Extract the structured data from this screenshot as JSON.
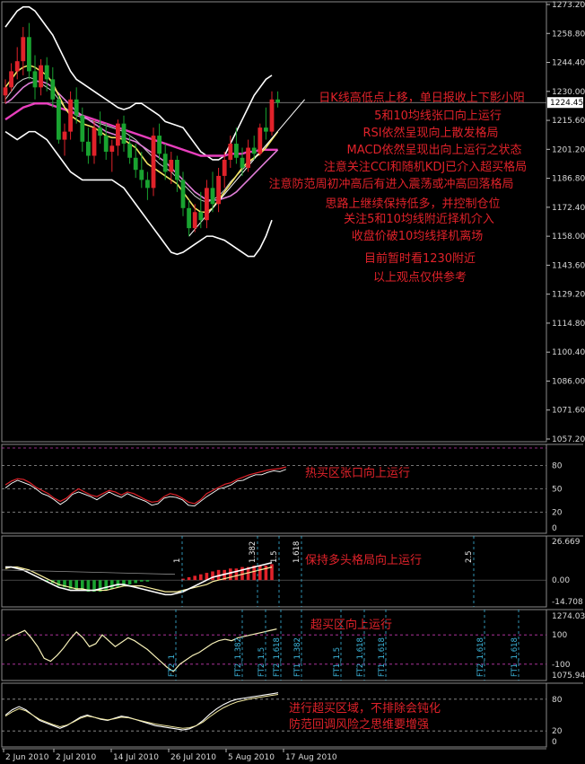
{
  "chart_data": [
    {
      "type": "candlestick",
      "panel": "price",
      "ylim": [
        1057.2,
        1273.2
      ],
      "y_ticks": [
        "1273.20",
        "1258.80",
        "1244.40",
        "1230.00",
        "1215.60",
        "1201.20",
        "1186.80",
        "1172.40",
        "1158.00",
        "1143.60",
        "1129.20",
        "1114.80",
        "1100.40",
        "1086.00",
        "1071.60",
        "1057.20"
      ],
      "last_price": "1224.45",
      "x_ticks": [
        "2 Jun 2010",
        "2 Jul 2010",
        "14 Jul 2010",
        "26 Jul 2010",
        "5 Aug 2010",
        "17 Aug 2010"
      ],
      "candles": [
        [
          1228,
          1236,
          1224,
          1232
        ],
        [
          1232,
          1244,
          1230,
          1240
        ],
        [
          1240,
          1252,
          1236,
          1245
        ],
        [
          1245,
          1262,
          1238,
          1257
        ],
        [
          1257,
          1264,
          1236,
          1240
        ],
        [
          1240,
          1248,
          1226,
          1232
        ],
        [
          1232,
          1246,
          1228,
          1243
        ],
        [
          1243,
          1247,
          1230,
          1236
        ],
        [
          1236,
          1242,
          1222,
          1226
        ],
        [
          1226,
          1228,
          1204,
          1206
        ],
        [
          1206,
          1214,
          1198,
          1210
        ],
        [
          1210,
          1230,
          1206,
          1226
        ],
        [
          1226,
          1232,
          1214,
          1218
        ],
        [
          1218,
          1222,
          1200,
          1205
        ],
        [
          1205,
          1212,
          1194,
          1198
        ],
        [
          1198,
          1216,
          1194,
          1212
        ],
        [
          1212,
          1220,
          1204,
          1208
        ],
        [
          1208,
          1214,
          1196,
          1200
        ],
        [
          1200,
          1206,
          1190,
          1203
        ],
        [
          1203,
          1216,
          1198,
          1214
        ],
        [
          1214,
          1218,
          1200,
          1204
        ],
        [
          1204,
          1208,
          1194,
          1197
        ],
        [
          1197,
          1204,
          1187,
          1191
        ],
        [
          1191,
          1200,
          1182,
          1186
        ],
        [
          1186,
          1190,
          1176,
          1182
        ],
        [
          1182,
          1212,
          1178,
          1208
        ],
        [
          1208,
          1214,
          1196,
          1199
        ],
        [
          1199,
          1204,
          1186,
          1190
        ],
        [
          1190,
          1200,
          1184,
          1196
        ],
        [
          1196,
          1198,
          1180,
          1186
        ],
        [
          1186,
          1190,
          1168,
          1172
        ],
        [
          1172,
          1176,
          1158,
          1162
        ],
        [
          1162,
          1174,
          1160,
          1170
        ],
        [
          1170,
          1180,
          1162,
          1166
        ],
        [
          1166,
          1186,
          1162,
          1182
        ],
        [
          1182,
          1190,
          1170,
          1174
        ],
        [
          1174,
          1192,
          1170,
          1188
        ],
        [
          1188,
          1200,
          1182,
          1196
        ],
        [
          1196,
          1208,
          1192,
          1204
        ],
        [
          1204,
          1212,
          1194,
          1197
        ],
        [
          1197,
          1202,
          1188,
          1192
        ],
        [
          1192,
          1206,
          1190,
          1202
        ],
        [
          1202,
          1208,
          1196,
          1199
        ],
        [
          1199,
          1214,
          1198,
          1212
        ],
        [
          1212,
          1222,
          1206,
          1210
        ],
        [
          1210,
          1230,
          1208,
          1226
        ],
        [
          1226,
          1230,
          1222,
          1224.45
        ]
      ],
      "bollinger_upper": [
        1262,
        1266,
        1270,
        1272,
        1272,
        1270,
        1266,
        1262,
        1258,
        1252,
        1246,
        1240,
        1236,
        1234,
        1232,
        1230,
        1228,
        1226,
        1224,
        1222,
        1221,
        1222,
        1224,
        1224,
        1222,
        1220,
        1218,
        1215,
        1214,
        1213,
        1212,
        1208,
        1204,
        1200,
        1198,
        1196,
        1196,
        1198,
        1204,
        1210,
        1216,
        1222,
        1228,
        1232,
        1236,
        1238
      ],
      "bollinger_mid": [
        1226,
        1230,
        1234,
        1236,
        1237,
        1236,
        1234,
        1232,
        1230,
        1226,
        1222,
        1220,
        1218,
        1217,
        1216,
        1215,
        1214,
        1213,
        1212,
        1211,
        1210,
        1208,
        1206,
        1203,
        1200,
        1197,
        1194,
        1192,
        1190,
        1187,
        1184,
        1181,
        1178,
        1176,
        1175,
        1176,
        1178,
        1181,
        1185,
        1188,
        1191,
        1194,
        1197,
        1200,
        1203,
        1206
      ],
      "bollinger_lower": [
        1210,
        1208,
        1206,
        1208,
        1210,
        1210,
        1208,
        1206,
        1202,
        1198,
        1194,
        1190,
        1188,
        1186,
        1186,
        1186,
        1186,
        1186,
        1186,
        1184,
        1182,
        1178,
        1174,
        1170,
        1166,
        1162,
        1158,
        1154,
        1150,
        1149,
        1150,
        1152,
        1154,
        1156,
        1158,
        1158,
        1157,
        1156,
        1154,
        1152,
        1150,
        1148,
        1148,
        1152,
        1158,
        1166
      ],
      "ma5": [
        1232,
        1236,
        1240,
        1242,
        1243,
        1242,
        1240,
        1238,
        1234,
        1228,
        1222,
        1218,
        1216,
        1214,
        1213,
        1212,
        1210,
        1208,
        1207,
        1207,
        1206,
        1204,
        1202,
        1198,
        1194,
        1192,
        1190,
        1188,
        1186,
        1184,
        1180,
        1176,
        1172,
        1170,
        1170,
        1172,
        1176,
        1180,
        1184,
        1188,
        1192,
        1195,
        1197,
        1199,
        1202,
        1206,
        1210
      ],
      "ma10": [
        1224,
        1226,
        1229,
        1232,
        1234,
        1235,
        1235,
        1234,
        1232,
        1229,
        1226,
        1223,
        1220,
        1218,
        1216,
        1214,
        1212,
        1210,
        1209,
        1208,
        1207,
        1206,
        1205,
        1203,
        1201,
        1199,
        1197,
        1195,
        1192,
        1189,
        1186,
        1183,
        1180,
        1178,
        1176,
        1176,
        1176,
        1177,
        1178,
        1180,
        1183,
        1186,
        1189,
        1192,
        1195,
        1198,
        1201
      ],
      "ma_long": [
        1216,
        1218,
        1220,
        1222,
        1223,
        1224,
        1224,
        1224,
        1223,
        1222,
        1221,
        1220,
        1219,
        1218,
        1217,
        1216,
        1215,
        1214,
        1213,
        1212,
        1211,
        1210,
        1209,
        1208,
        1207,
        1206,
        1205,
        1204,
        1203,
        1202,
        1201,
        1200,
        1199,
        1198,
        1198,
        1198,
        1198,
        1198,
        1199,
        1199,
        1199,
        1200,
        1200,
        1201,
        1201,
        1201,
        1201
      ]
    },
    {
      "type": "line",
      "panel": "rsi",
      "ylim": [
        0,
        100
      ],
      "y_ticks": [
        "80",
        "50",
        "20",
        "0"
      ],
      "series": [
        {
          "values": [
            55,
            60,
            63,
            62,
            58,
            52,
            48,
            44,
            38,
            34,
            38,
            45,
            50,
            46,
            42,
            40,
            44,
            48,
            46,
            42,
            46,
            44,
            40,
            36,
            33,
            34,
            40,
            44,
            42,
            38,
            33,
            31,
            36,
            44,
            48,
            52,
            56,
            58,
            62,
            65,
            68,
            70,
            72,
            74,
            75,
            76,
            78
          ]
        }
      ]
    },
    {
      "type": "bar",
      "panel": "macd",
      "ylim": [
        -14.708,
        26.669
      ],
      "y_ticks": [
        "26.669",
        "0.00",
        "-14.708"
      ],
      "fib_labels": [
        "1",
        "1.382",
        "1.5",
        "1.618",
        "2.5"
      ],
      "histogram": [
        0,
        0,
        0,
        0,
        0,
        0,
        0,
        -1,
        -2,
        -4,
        -5,
        -6,
        -7,
        -7,
        -8,
        -8,
        -8,
        -7,
        -6,
        -5,
        -4,
        -3,
        -2,
        -1,
        -1,
        0,
        0,
        0,
        0,
        0,
        1,
        2,
        3,
        4,
        5,
        6,
        7,
        7,
        8,
        8,
        9,
        9,
        10,
        10,
        10,
        11
      ],
      "signal": [
        8,
        9,
        9,
        8,
        7,
        5,
        3,
        1,
        -1,
        -3,
        -4,
        -5,
        -6,
        -6,
        -7,
        -7,
        -7,
        -7,
        -6,
        -5,
        -4,
        -4,
        -4,
        -4,
        -5,
        -6,
        -7,
        -8,
        -8,
        -8,
        -7,
        -6,
        -5,
        -4,
        -3,
        -1,
        0,
        1,
        2,
        3,
        4,
        5,
        6,
        7,
        8,
        9
      ],
      "macd": [
        9,
        9,
        8,
        7,
        5,
        3,
        1,
        -1,
        -3,
        -5,
        -6,
        -7,
        -7,
        -7,
        -7,
        -7,
        -6,
        -5,
        -4,
        -3,
        -3,
        -4,
        -5,
        -6,
        -7,
        -8,
        -9,
        -10,
        -10,
        -9,
        -8,
        -6,
        -4,
        -2,
        0,
        2,
        3,
        4,
        5,
        6,
        7,
        8,
        9,
        10,
        11,
        12
      ]
    },
    {
      "type": "line",
      "panel": "cci",
      "ylim": [
        1075.946,
        1274.034
      ],
      "y_ticks": [
        "1274.034",
        "100",
        "-100",
        "1075.946"
      ],
      "fib_labels": [
        "FT2_1",
        "FT2_1.382",
        "FT2_1.5",
        "FT2_1.618",
        "FT1_1.382",
        "FT1_1.5",
        "FT2_1.618",
        "FT1_1.618",
        "FT2_1.618",
        "FT1_1.618"
      ],
      "series": [
        {
          "values": [
            60,
            90,
            110,
            130,
            80,
            20,
            -60,
            -80,
            -40,
            10,
            70,
            120,
            80,
            20,
            40,
            100,
            60,
            20,
            50,
            80,
            60,
            30,
            0,
            -40,
            -80,
            -120,
            -150,
            -100,
            -70,
            -40,
            -20,
            10,
            40,
            60,
            70,
            60,
            80,
            90,
            100,
            110,
            120,
            130,
            140
          ]
        }
      ]
    },
    {
      "type": "line",
      "panel": "kdj",
      "ylim": [
        0,
        100
      ],
      "y_ticks": [
        "80",
        "20",
        "0"
      ],
      "series": [
        {
          "values": [
            50,
            60,
            66,
            60,
            50,
            40,
            35,
            30,
            25,
            30,
            38,
            46,
            50,
            46,
            42,
            40,
            44,
            48,
            46,
            42,
            38,
            34,
            30,
            28,
            26,
            24,
            22,
            24,
            30,
            40,
            52,
            62,
            70,
            76,
            80,
            82,
            84,
            86,
            88,
            90,
            92
          ]
        },
        {
          "values": [
            48,
            56,
            62,
            58,
            50,
            42,
            37,
            32,
            28,
            31,
            37,
            44,
            48,
            46,
            43,
            41,
            43,
            46,
            45,
            42,
            39,
            36,
            33,
            31,
            29,
            27,
            25,
            26,
            30,
            37,
            47,
            56,
            64,
            70,
            75,
            78,
            81,
            83,
            85,
            87,
            89
          ]
        }
      ]
    }
  ],
  "annotations": {
    "price": [
      "日K线高低点上移，单日报收上下影小阳",
      "5和10均线张口向上运行",
      "RSI依然呈现向上散发格局",
      "MACD依然呈现出向上运行之状态",
      "注意关注CCI和随机KDJ已介入超买格局",
      "注意防范周初冲高后有进入震荡或冲高回落格局",
      "思路上继续保持低多，并控制仓位",
      "关注5和10均线附近择机介入",
      "收盘价破10均线择机离场",
      "目前暂时看1230附近",
      "以上观点仅供参考"
    ],
    "rsi": "热买区张口向上运行",
    "macd": "保持多头格局向上运行",
    "cci": "超买区向上运行",
    "kdj": [
      "进行超买区域，不排除会钝化",
      "防范回调风险之思维要增强"
    ]
  },
  "colors": {
    "bull": "#e0222a",
    "bear": "#19a330",
    "bollinger": "#ffffff",
    "ma5": "#f4e463",
    "ma10": "#e07ed8",
    "ma_long": "#e83fbd",
    "rsi": "#e0222a",
    "grid_dash": "#c43bb0",
    "annotation": "#e0222a",
    "fib": "#3cb6dc"
  }
}
